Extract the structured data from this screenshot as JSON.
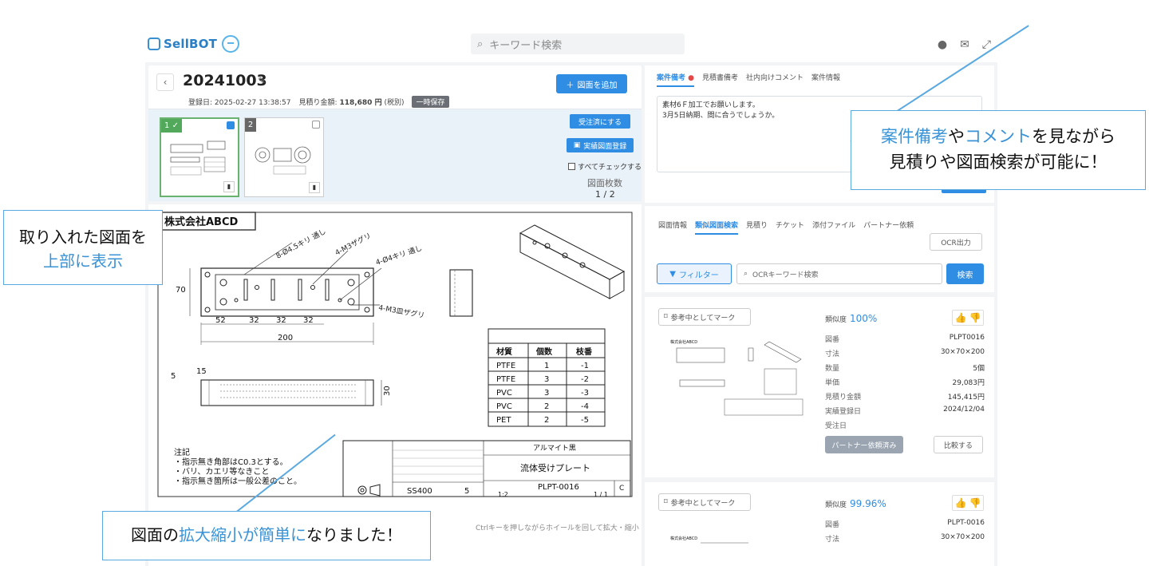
{
  "app": {
    "logo_text": "SellBOT",
    "search_placeholder": "キーワード検索"
  },
  "doc": {
    "title": "20241003",
    "registered_label": "登録日:",
    "registered_value": "2025-02-27 13:38:57",
    "estimate_label": "見積り金額:",
    "estimate_value": "118,680 円",
    "tax_note": "(税別)",
    "temp_badge": "一時保存",
    "add_button": "図面を追加",
    "order_button": "受注済にする",
    "register_button": "実績図面登録",
    "check_all": "すべてチェックする",
    "count_label": "図面枚数",
    "count_value": "1 / 2",
    "thumbs": [
      {
        "num": "1"
      },
      {
        "num": "2"
      }
    ]
  },
  "drawing": {
    "company": "株式会社ABCD",
    "callouts": [
      "8-Ø4.5キリ 通し",
      "4-M3ザグリ",
      "4-Ø4キリ 通し",
      "4-M3皿ザグリ"
    ],
    "dims": [
      "52",
      "32",
      "32",
      "32",
      "200",
      "70",
      "5",
      "15",
      "30"
    ],
    "table_headers": [
      "材質",
      "個数",
      "枝番"
    ],
    "table_rows": [
      [
        "PTFE",
        "1",
        "-1"
      ],
      [
        "PTFE",
        "3",
        "-2"
      ],
      [
        "PVC",
        "3",
        "-3"
      ],
      [
        "PVC",
        "2",
        "-4"
      ],
      [
        "PET",
        "2",
        "-5"
      ]
    ],
    "notes_title": "注記",
    "notes": [
      "・指示無き角部はC0.3とする。",
      "・バリ、カエリ等なきこと",
      "・指示無き箇所は一般公差のこと。"
    ],
    "finish": "アルマイト黒",
    "part_name": "流体受けプレート",
    "material": "SS400",
    "qty": "5",
    "part_no": "PLPT-0016",
    "rev": "C",
    "scale": "1:2",
    "sheet": "1 / 1",
    "hint": "Ctrlキーを押しながらホイールを回して拡大・縮小"
  },
  "notes_panel": {
    "tabs": [
      "案件備考",
      "見積書備考",
      "社内向けコメント",
      "案件情報"
    ],
    "lines": [
      "素材6Ｆ加工でお願いします。",
      "3月5日納期、間に合うでしょうか。"
    ]
  },
  "search_panel": {
    "tabs": [
      "図面情報",
      "類似図面検索",
      "見積り",
      "チケット",
      "添付ファイル",
      "パートナー依頼"
    ],
    "ocr_button": "OCR出力",
    "filter_button": "フィルター",
    "ocr_placeholder": "OCRキーワード検索",
    "search_button": "検索",
    "results": [
      {
        "mark": "参考中としてマーク",
        "similarity_label": "類似度",
        "similarity": "100%",
        "fields": [
          {
            "k": "図番",
            "v": "PLPT0016"
          },
          {
            "k": "寸法",
            "v": "30×70×200"
          },
          {
            "k": "数量",
            "v": "5個"
          },
          {
            "k": "単価",
            "v": "29,083円"
          },
          {
            "k": "見積り金額",
            "v": "145,415円"
          },
          {
            "k": "実績登録日",
            "v": "2024/12/04"
          },
          {
            "k": "受注日",
            "v": ""
          }
        ],
        "partner_button": "パートナー依頼済み",
        "compare_button": "比較する"
      },
      {
        "mark": "参考中としてマーク",
        "similarity_label": "類似度",
        "similarity": "99.96%",
        "fields": [
          {
            "k": "図番",
            "v": "PLPT-0016"
          },
          {
            "k": "寸法",
            "v": "30×70×200"
          }
        ]
      }
    ]
  },
  "annotations": {
    "top_right": {
      "accent1": "案件備考",
      "sep": "や",
      "accent2": "コメント",
      "rest1": "を見ながら",
      "line2": "見積りや図面検索が可能に！"
    },
    "left": {
      "line1": "取り入れた図面を",
      "accent": "上部に表示"
    },
    "bottom": {
      "pre": "図面の",
      "accent": "拡大縮小が簡単に",
      "post": "なりました！"
    }
  },
  "colors": {
    "accent": "#2f8de4",
    "callout_border": "#5aa9e0",
    "success": "#52a85b"
  }
}
